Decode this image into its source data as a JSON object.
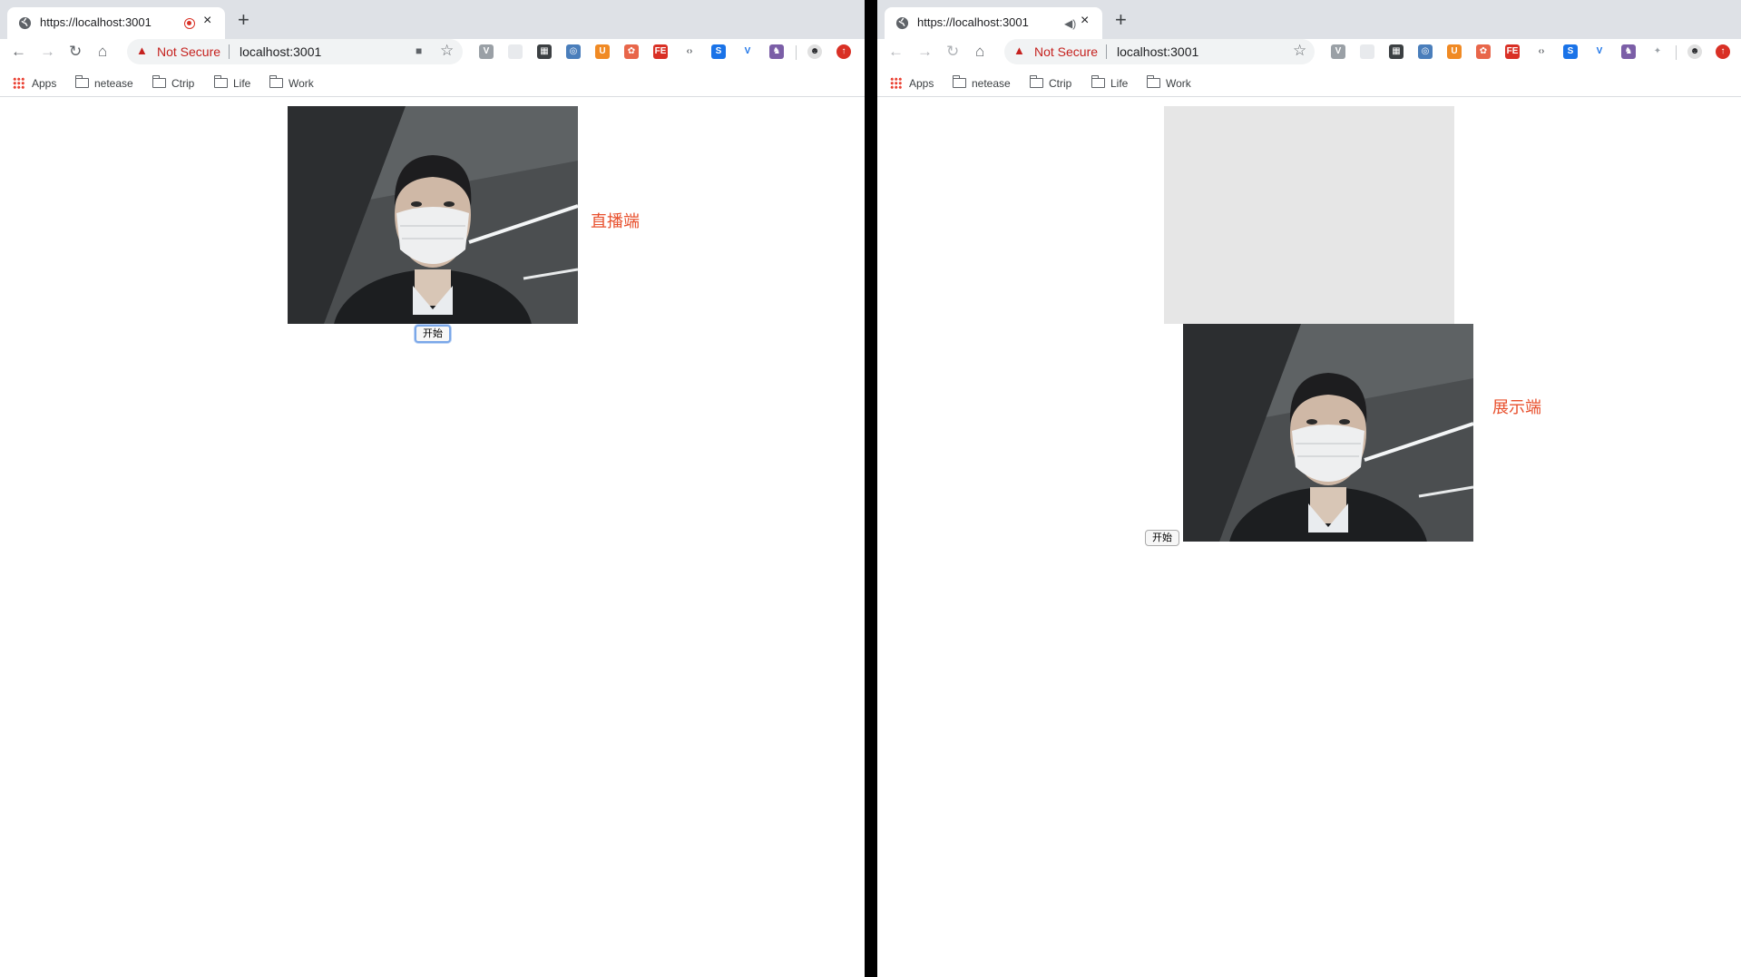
{
  "left": {
    "tab_title": "https://localhost:3001",
    "new_tab": "+",
    "close": "×",
    "not_secure": "Not Secure",
    "url": "localhost:3001",
    "bookmarks": [
      "Apps",
      "netease",
      "Ctrip",
      "Life",
      "Work"
    ],
    "stream_label": "直播端",
    "start_button": "开始"
  },
  "right": {
    "tab_title": "https://localhost:3001",
    "new_tab": "+",
    "close": "×",
    "not_secure": "Not Secure",
    "url": "localhost:3001",
    "bookmarks": [
      "Apps",
      "netease",
      "Ctrip",
      "Life",
      "Work"
    ],
    "display_label": "展示端",
    "start_button": "开始"
  },
  "colors": {
    "label": "#e8502d",
    "warning": "#c5221f"
  }
}
